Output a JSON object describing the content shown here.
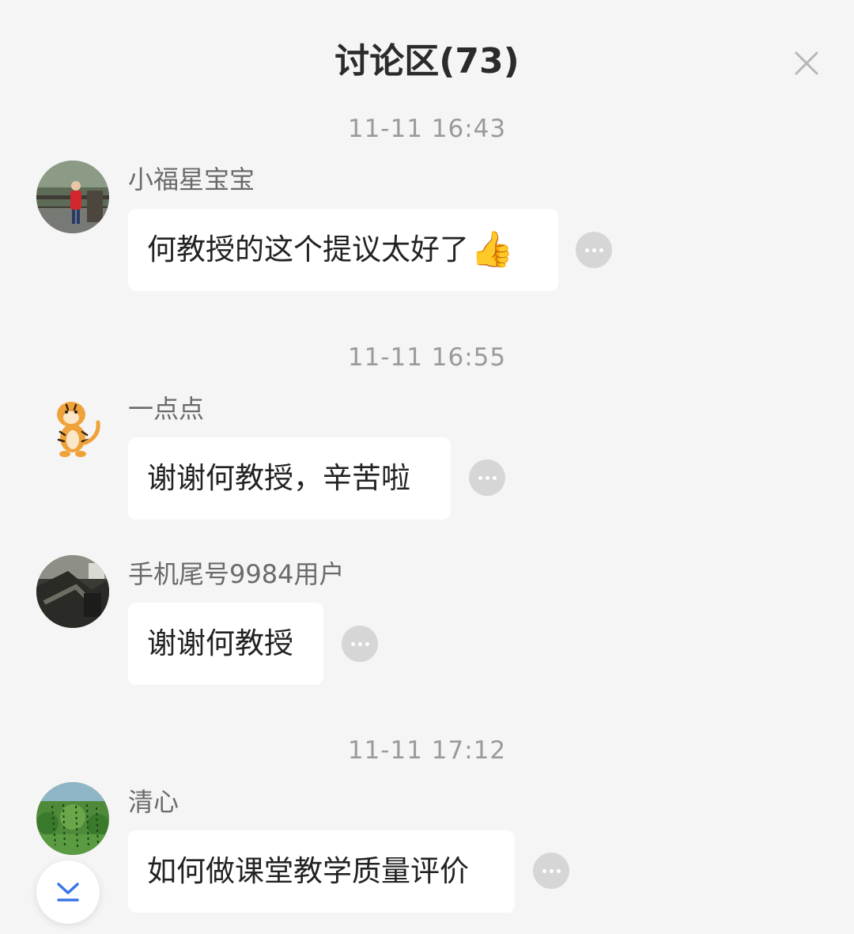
{
  "header": {
    "title": "讨论区(73)",
    "close_icon": "close-icon"
  },
  "messages": [
    {
      "timestamp": "11-11 16:43",
      "user": "小福星宝宝",
      "text": "何教授的这个提议太好了",
      "emoji": "👍",
      "avatar": "child-in-red-photo"
    },
    {
      "timestamp": "11-11 16:55",
      "user": "一点点",
      "text": "谢谢何教授，辛苦啦",
      "avatar": "tiger-cartoon"
    },
    {
      "user": "手机尾号9984用户",
      "text": "谢谢何教授",
      "avatar": "dark-photo"
    },
    {
      "timestamp": "11-11 17:12",
      "user": "清心",
      "text": "如何做课堂教学质量评价",
      "avatar": "green-calligraphy-photo"
    }
  ],
  "controls": {
    "more_icon": "more-dots-icon",
    "scroll_icon": "chevron-double-down-icon"
  },
  "colors": {
    "background": "#f5f5f5",
    "bubble": "#ffffff",
    "accent": "#3a76e8"
  }
}
